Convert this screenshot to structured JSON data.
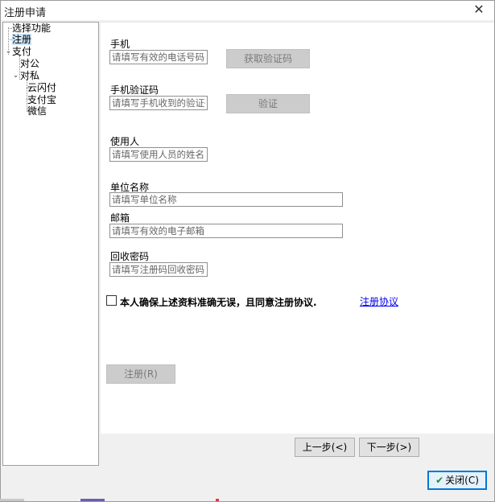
{
  "window": {
    "title": "注册申请",
    "close_glyph": "✕"
  },
  "tree": {
    "items": [
      {
        "label": "选择功能"
      },
      {
        "label": "注册"
      },
      {
        "label": "支付"
      },
      {
        "label": "对公"
      },
      {
        "label": "对私"
      },
      {
        "label": "云闪付"
      },
      {
        "label": "支付宝"
      },
      {
        "label": "微信"
      }
    ]
  },
  "form": {
    "phone": {
      "label": "手机",
      "placeholder": "请填写有效的电话号码"
    },
    "get_code_label": "获取验证码",
    "code": {
      "label": "手机验证码",
      "placeholder": "请填写手机收到的验证码"
    },
    "verify_label": "验证",
    "user": {
      "label": "使用人",
      "placeholder": "请填写使用人员的姓名"
    },
    "company": {
      "label": "单位名称",
      "placeholder": "请填写单位名称"
    },
    "email": {
      "label": "邮箱",
      "placeholder": "请填写有效的电子邮箱"
    },
    "recovery": {
      "label": "回收密码",
      "placeholder": "请填写注册码回收密码"
    },
    "agree_text": "本人确保上述资料准确无误，且同意注册协议.",
    "agreement_link": "注册协议",
    "register_label": "注册(R)"
  },
  "nav": {
    "prev_label": "上一步(<)",
    "next_label": "下一步(>)"
  },
  "footer": {
    "close_label": "关闭(C)"
  }
}
